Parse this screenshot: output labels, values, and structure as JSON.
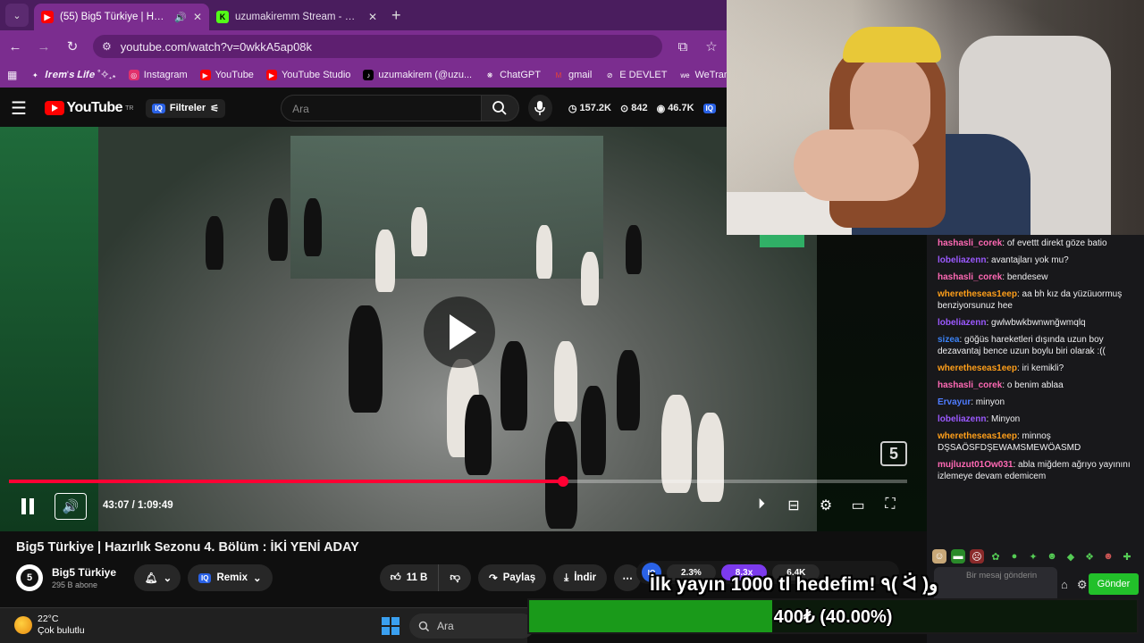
{
  "browser": {
    "tabs": [
      {
        "title": "(55) Big5 Türkiye | Hazırlık S",
        "active": true
      },
      {
        "title": "uzumakiremm Stream - Watch",
        "active": false
      }
    ],
    "url": "youtube.com/watch?v=0wkkA5ap08k",
    "bookmarks": [
      {
        "label": "𝑰𝒓𝒆𝒎'𝒔 𝑳𝒊𝒇𝒆 ˚✧₊⁎",
        "icon": "star-icon"
      },
      {
        "label": "Instagram",
        "icon": "instagram-icon"
      },
      {
        "label": "YouTube",
        "icon": "youtube-icon"
      },
      {
        "label": "YouTube Studio",
        "icon": "youtube-studio-icon"
      },
      {
        "label": "uzumakirem (@uzu...",
        "icon": "tiktok-icon"
      },
      {
        "label": "ChatGPT",
        "icon": "chatgpt-icon"
      },
      {
        "label": "gmail",
        "icon": "gmail-icon"
      },
      {
        "label": "E DEVLET",
        "icon": "edevlet-icon"
      },
      {
        "label": "WeTransfe",
        "icon": "wetransfer-icon"
      }
    ]
  },
  "youtube": {
    "logo_text": "YouTube",
    "region": "TR",
    "filters_label": "Filtreler",
    "search_placeholder": "Ara",
    "stats": {
      "views": "157.2K",
      "likes": "842",
      "watching": "46.7K"
    },
    "video": {
      "time": "43:07 / 1:09:49",
      "progress_fraction": 0.617,
      "channel_badge": "5"
    },
    "title": "Big5 Türkiye | Hazırlık Sezonu 4. Bölüm : İKİ YENİ ADAY",
    "channel": {
      "name": "Big5 Türkiye",
      "subs": "295 B abone",
      "avatar_letter": "5"
    },
    "actions": {
      "remix": "Remix",
      "likes": "11 B",
      "share": "Paylaş",
      "download": "İndir"
    },
    "iq_stats": [
      "2.3%",
      "8.3x",
      "6.4K"
    ]
  },
  "chat": {
    "messages": [
      {
        "user": "hashasli_corek",
        "color": "#ff69b4",
        "text": "of evettt direkt göze batio"
      },
      {
        "user": "lobeliazenn",
        "color": "#9b59ff",
        "text": "avantajları yok mu?"
      },
      {
        "user": "hashasli_corek",
        "color": "#ff69b4",
        "text": "bendesew"
      },
      {
        "user": "wheretheseas1eep",
        "color": "#ff9f1a",
        "text": "aa bh kız da yüzüuormuş benziyorsunuz hee"
      },
      {
        "user": "lobeliazenn",
        "color": "#9b59ff",
        "text": "gwlwbwkbwnwnğwmqlq"
      },
      {
        "user": "sizea",
        "color": "#3b82f6",
        "text": "göğüs hareketleri dışında uzun boy dezavantaj bence uzun boylu biri olarak :(("
      },
      {
        "user": "wheretheseas1eep",
        "color": "#ff9f1a",
        "text": "iri kemikli?"
      },
      {
        "user": "hashasli_corek",
        "color": "#ff69b4",
        "text": "o benim ablaa"
      },
      {
        "user": "Ervayur",
        "color": "#4f7cff",
        "text": "minyon"
      },
      {
        "user": "lobeliazenn",
        "color": "#9b59ff",
        "text": "Minyon"
      },
      {
        "user": "wheretheseas1eep",
        "color": "#ff9f1a",
        "text": "minnoş DŞSAÖSFDŞEWAMSMEWÖASMD"
      },
      {
        "user": "mujluzut01Ow031",
        "color": "#ff69b4",
        "text": "abla miğdem ağrıyo yayınını izlemeye devam edemicem"
      }
    ],
    "input_placeholder": "Bir mesaj gönderin",
    "send_label": "Gönder"
  },
  "overlay": {
    "goal_text": "İlk yayın 1000 tl hedefim! ٩( ᐛ )و",
    "goal_label": "400₺ (40.00%)",
    "goal_fraction": 0.4
  },
  "taskbar": {
    "temp": "22°C",
    "weather": "Çok bulutlu",
    "search": "Ara"
  }
}
